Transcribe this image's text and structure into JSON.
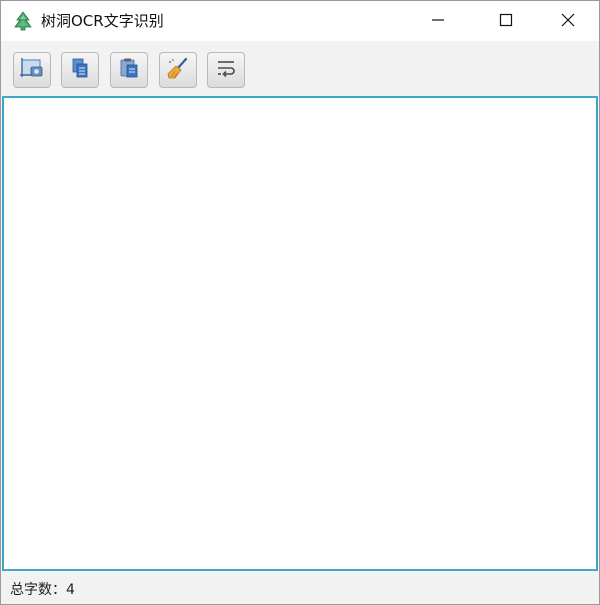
{
  "window": {
    "title": "树洞OCR文字识别",
    "icons": {
      "app": "tree-icon",
      "minimize": "minimize-icon",
      "maximize": "maximize-icon",
      "close": "close-icon"
    }
  },
  "toolbar": {
    "buttons": [
      {
        "icon": "screenshot-icon"
      },
      {
        "icon": "copy-icon"
      },
      {
        "icon": "paste-icon"
      },
      {
        "icon": "clear-broom-icon"
      },
      {
        "icon": "wrap-text-icon"
      }
    ]
  },
  "editor": {
    "content": "",
    "accent_color": "#3fa8c8"
  },
  "status": {
    "label": "总字数：",
    "count": "4"
  }
}
